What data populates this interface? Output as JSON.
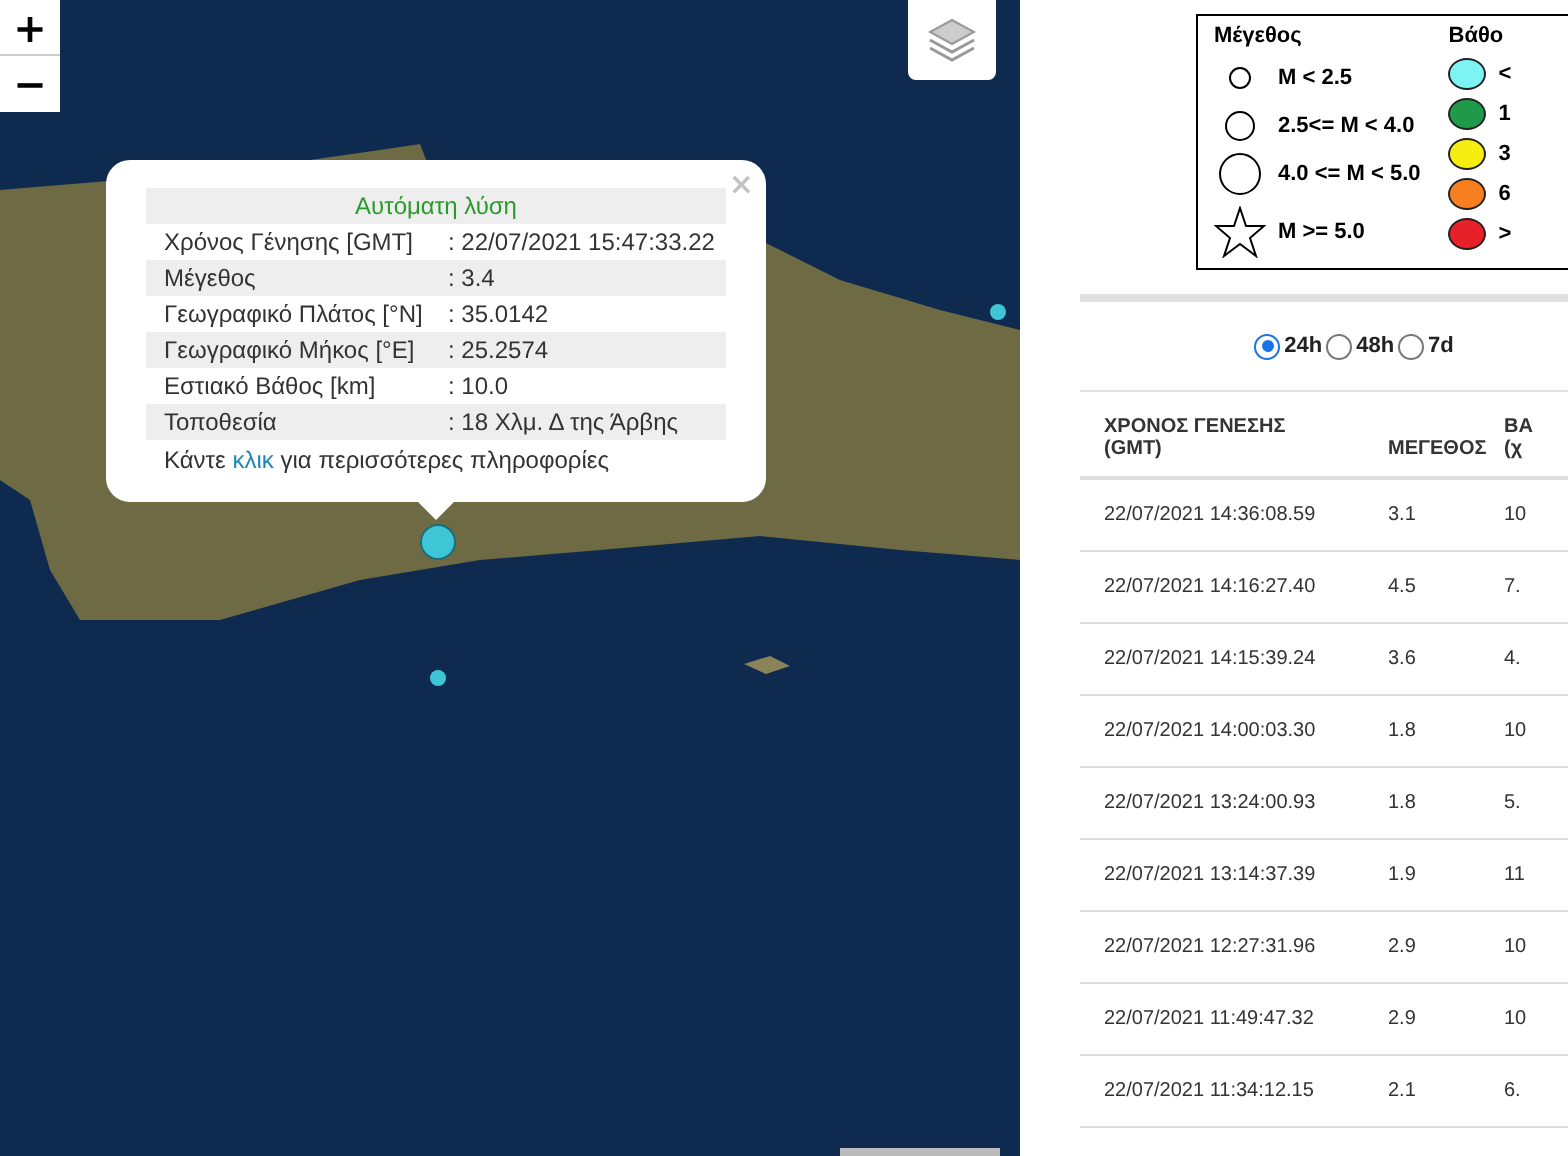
{
  "map": {
    "zoom_in": "+",
    "zoom_out": "−",
    "markers": [
      {
        "color": "#3ec6d6"
      },
      {
        "color": "#3ec6d6"
      },
      {
        "color": "#3ec6d6"
      }
    ],
    "popup": {
      "title": "Αυτόματη λύση",
      "close": "×",
      "rows": [
        {
          "label": "Χρόνος Γένησης [GMT]",
          "value": ": 22/07/2021 15:47:33.22"
        },
        {
          "label": "Μέγεθος",
          "value": ": 3.4"
        },
        {
          "label": "Γεωγραφικό Πλάτος [°N]",
          "value": ": 35.0142"
        },
        {
          "label": "Γεωγραφικό Μήκος [°E]",
          "value": ": 25.2574"
        },
        {
          "label": "Εστιακό Βάθος [km]",
          "value": ": 10.0"
        },
        {
          "label": "Τοποθεσία",
          "value": ": 18 Χλμ. Δ της Άρβης"
        }
      ],
      "footer": {
        "before": "Κάντε",
        "link": "κλικ",
        "after": "για περισσότερες πληροφορίες"
      }
    }
  },
  "legend": {
    "magnitude": {
      "title": "Μέγεθος",
      "items": [
        {
          "kind": "circle",
          "label": "M < 2.5"
        },
        {
          "kind": "circle",
          "label": "2.5<= M < 4.0"
        },
        {
          "kind": "circle",
          "label": "4.0 <= M < 5.0"
        },
        {
          "kind": "star",
          "label": "M >= 5.0"
        }
      ]
    },
    "depth": {
      "title": "Βάθο",
      "items": [
        {
          "color": "#7ef3f3",
          "label": "<"
        },
        {
          "color": "#1e9a4a",
          "label": "1"
        },
        {
          "color": "#f5ee10",
          "label": "3"
        },
        {
          "color": "#f77f20",
          "label": "6"
        },
        {
          "color": "#e8202a",
          "label": ">"
        }
      ]
    }
  },
  "periods": [
    {
      "label": "24h",
      "selected": true
    },
    {
      "label": "48h",
      "selected": false
    },
    {
      "label": "7d",
      "selected": false
    }
  ],
  "table": {
    "columns": [
      "ΧΡΟΝΟΣ ΓΕΝΕΣΗΣ (GMT)",
      "ΜΕΓΕΘΟΣ",
      "ΒΑ (χ"
    ],
    "rows": [
      [
        "22/07/2021 14:36:08.59",
        "3.1",
        "10"
      ],
      [
        "22/07/2021 14:16:27.40",
        "4.5",
        "7."
      ],
      [
        "22/07/2021 14:15:39.24",
        "3.6",
        "4."
      ],
      [
        "22/07/2021 14:00:03.30",
        "1.8",
        "10"
      ],
      [
        "22/07/2021 13:24:00.93",
        "1.8",
        "5."
      ],
      [
        "22/07/2021 13:14:37.39",
        "1.9",
        "11"
      ],
      [
        "22/07/2021 12:27:31.96",
        "2.9",
        "10"
      ],
      [
        "22/07/2021 11:49:47.32",
        "2.9",
        "10"
      ],
      [
        "22/07/2021 11:34:12.15",
        "2.1",
        "6."
      ]
    ]
  }
}
